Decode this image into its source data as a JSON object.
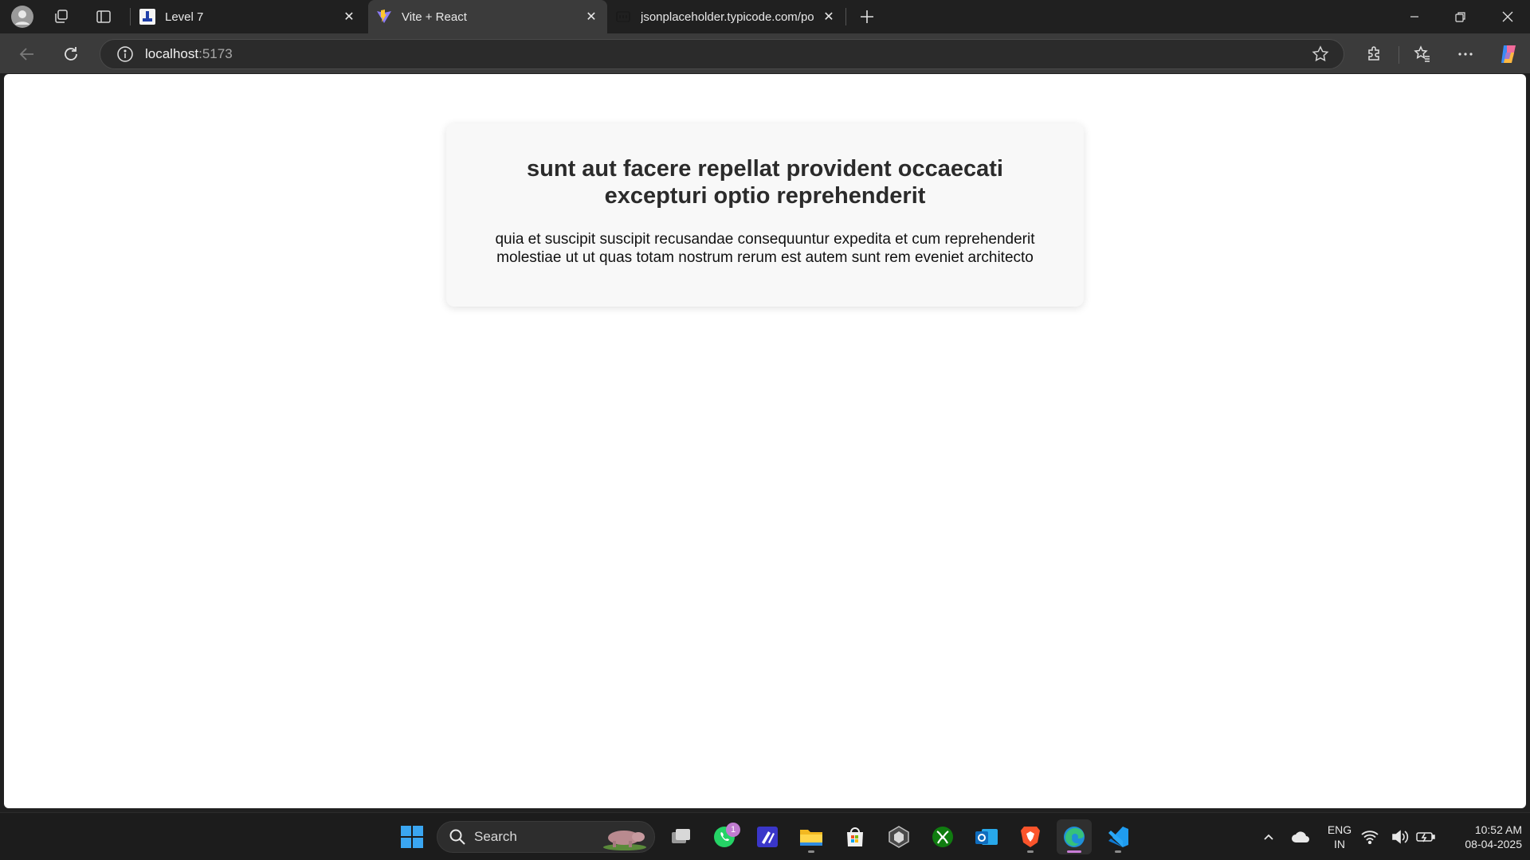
{
  "browser": {
    "tabs": [
      {
        "label": "Level 7",
        "active": false
      },
      {
        "label": "Vite + React",
        "active": true
      },
      {
        "label": "jsonplaceholder.typicode.com/po",
        "active": false
      }
    ],
    "address": {
      "host": "localhost",
      "port": ":5173"
    }
  },
  "page": {
    "post": {
      "title": "sunt aut facere repellat provident occaecati excepturi optio reprehenderit",
      "body": "quia et suscipit suscipit recusandae consequuntur expedita et cum reprehenderit molestiae ut ut quas totam nostrum rerum est autem sunt rem eveniet architecto"
    }
  },
  "taskbar": {
    "search_label": "Search",
    "whatsapp_badge": "1",
    "language": {
      "line1": "ENG",
      "line2": "IN"
    },
    "clock": {
      "time": "10:52 AM",
      "date": "08-04-2025"
    }
  },
  "colors": {
    "tab_active": "#3b3b3b",
    "page_background": "#ffffff",
    "card_background": "#f8f8f8",
    "accent": "#c87dd6"
  }
}
